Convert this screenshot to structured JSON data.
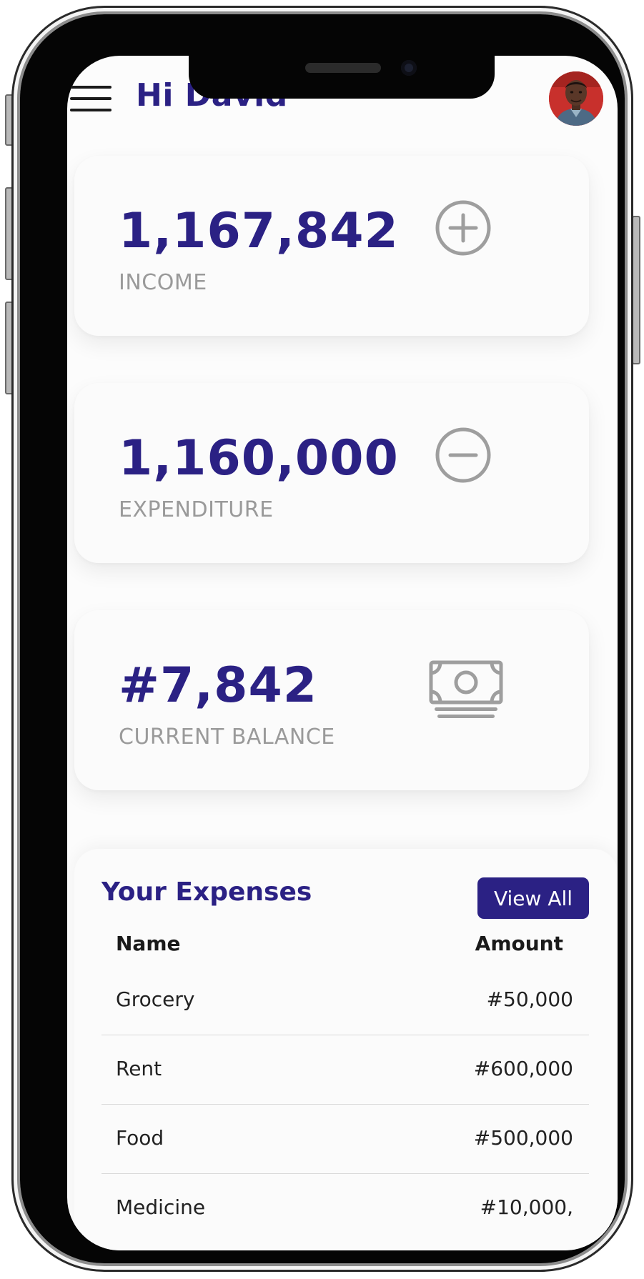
{
  "header": {
    "greeting": "Hi David"
  },
  "cards": [
    {
      "value": "1,167,842",
      "label": "INCOME",
      "icon": "plus-circle-icon"
    },
    {
      "value": "1,160,000",
      "label": "EXPENDITURE",
      "icon": "minus-circle-icon"
    },
    {
      "value": "#7,842",
      "label": "CURRENT BALANCE",
      "icon": "money-bill-icon"
    }
  ],
  "expenses": {
    "title": "Your Expenses",
    "view_all_label": "View All",
    "columns": {
      "name": "Name",
      "amount": "Amount"
    },
    "rows": [
      {
        "name": "Grocery",
        "amount": "#50,000"
      },
      {
        "name": "Rent",
        "amount": "#600,000"
      },
      {
        "name": "Food",
        "amount": "#500,000"
      },
      {
        "name": "Medicine",
        "amount": "#10,000,"
      }
    ]
  },
  "colors": {
    "accent": "#2b2184",
    "label_gray": "#9a9a9a",
    "icon_gray": "#9e9e9e",
    "card_bg": "#fbfbfb"
  }
}
